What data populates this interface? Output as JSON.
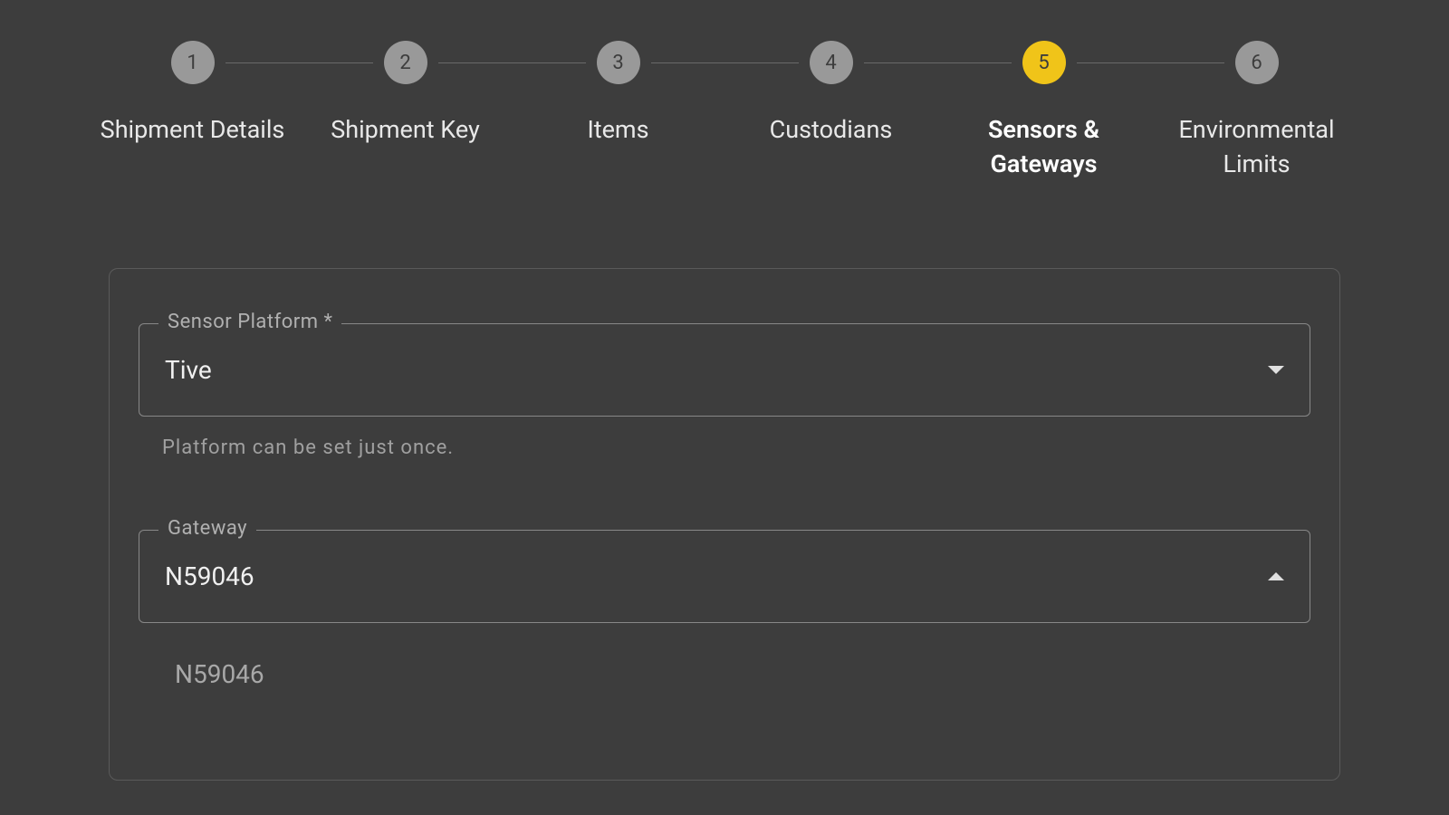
{
  "stepper": {
    "steps": [
      {
        "number": "1",
        "label": "Shipment Details",
        "active": false
      },
      {
        "number": "2",
        "label": "Shipment Key",
        "active": false
      },
      {
        "number": "3",
        "label": "Items",
        "active": false
      },
      {
        "number": "4",
        "label": "Custodians",
        "active": false
      },
      {
        "number": "5",
        "label": "Sensors & Gateways",
        "active": true
      },
      {
        "number": "6",
        "label": "Environmental Limits",
        "active": false
      }
    ]
  },
  "form": {
    "sensor_platform": {
      "label": "Sensor Platform *",
      "value": "Tive",
      "helper": "Platform can be set just once."
    },
    "gateway": {
      "label": "Gateway",
      "value": "N59046",
      "options": [
        "N59046"
      ]
    }
  }
}
